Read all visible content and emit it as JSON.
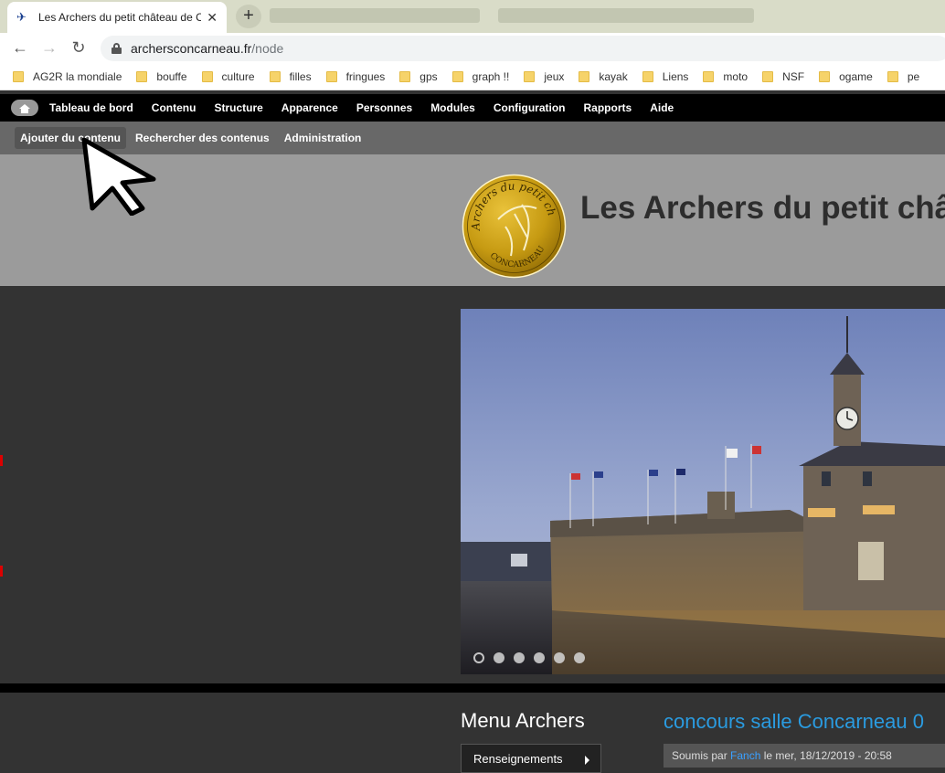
{
  "browser": {
    "tab_title": "Les Archers du petit château de C",
    "url_host": "archersconcarneau.fr",
    "url_path": "/node",
    "bookmarks": [
      "AG2R la mondiale",
      "bouffe",
      "culture",
      "filles",
      "fringues",
      "gps",
      "graph !!",
      "jeux",
      "kayak",
      "Liens",
      "moto",
      "NSF",
      "ogame",
      "pe"
    ]
  },
  "admin_menu": [
    "Tableau de bord",
    "Contenu",
    "Structure",
    "Apparence",
    "Personnes",
    "Modules",
    "Configuration",
    "Rapports",
    "Aide"
  ],
  "shortcuts": [
    "Ajouter du contenu",
    "Rechercher des contenus",
    "Administration"
  ],
  "site": {
    "name": "Les Archers du petit chât",
    "logo_text_top": "Archers du petit château",
    "logo_text_bottom": "CONCARNEAU"
  },
  "slider": {
    "slides": 6,
    "active": 0
  },
  "sidebar": {
    "title": "Menu Archers",
    "items": [
      "Renseignements"
    ]
  },
  "node": {
    "title": "concours salle Concarneau 0",
    "submitted_prefix": "Soumis par",
    "submitted_user": "Fanch",
    "submitted_suffix": "le mer, 18/12/2019 - 20:58"
  },
  "colors": {
    "link": "#2a9be0",
    "admin_bar": "#000000",
    "shortcut_bar": "#686868",
    "header": "#9b9b9b"
  }
}
